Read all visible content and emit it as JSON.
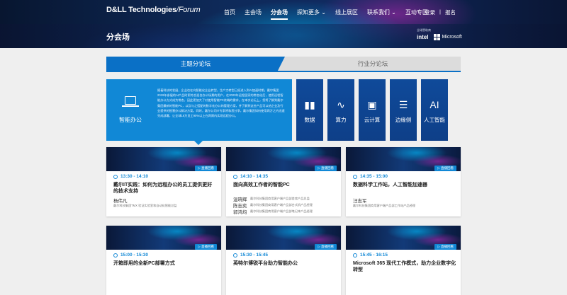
{
  "header": {
    "brand": "D&LL Technologies",
    "brand_suffix": "/Forum",
    "nav": [
      "首页",
      "主会场",
      "分会场",
      "探知更多 ⌄",
      "线上展区",
      "联系我们 ⌄",
      "互动专区 ⌄"
    ],
    "active_nav": "分会场",
    "login": "登录",
    "separator": "|",
    "register": "报名",
    "page_title": "分会场",
    "sponsor_caption": "全球赞助商",
    "sponsor_intel": "intel",
    "sponsor_ms": "Microsoft"
  },
  "tabs": {
    "active": "主题分论坛",
    "inactive": "行业分论坛"
  },
  "featured": {
    "icon": "laptop-icon",
    "name": "智能办公",
    "desc": "随着科技的发展，企业也在向智能化企业转型，生产力转型已经进入到AI加速时期。戴尔集团2019年参展的AI产品时更符合混合办公场景的用户，在2020年远程居家的常态化后，使用远程智能办公方式成为常态，因此更加大了对使用智能PC终端的需求。在本次论坛上，您将了解到戴尔集团最新的智能PC，以及与之搭配的数字化办公的管理方案，并了解到这些产品可以给企业及行业提供的智慧办公解决方案。同时，戴尔公司IT专家将和您分享，戴尔集团如何使用两万之内迅速完成部署，让全球16万员工90%以上在两周内实现远程办公。"
  },
  "topics": [
    {
      "glyph": "▮▮",
      "label": "数据",
      "icon": "bar-chart-icon"
    },
    {
      "glyph": "∿",
      "label": "算力",
      "icon": "line-chart-icon"
    },
    {
      "glyph": "▣",
      "label": "云计算",
      "icon": "monitor-icon"
    },
    {
      "glyph": "☰",
      "label": "边缘侧",
      "icon": "server-icon"
    },
    {
      "glyph": "AI",
      "label": "人工智能",
      "icon": "ai-icon"
    }
  ],
  "replay_label": "▷ 直播回看",
  "sessions": [
    {
      "time": "13:30 - 14:10",
      "title": "戴尔IT实践：如何为远程办公的员工提供更好的技术支持",
      "speakers": [
        {
          "name": "杨伟凡",
          "role": "戴尔科技集团TMX 验证实验室和自动化智能总监"
        }
      ]
    },
    {
      "time": "14:10 - 14:35",
      "title": "面向高效工作者的智能PC",
      "speakers": [
        {
          "name": "温晓辉",
          "role": "戴尔科技集团商用客户端产品部首席产品总监"
        },
        {
          "name": "陈志奕",
          "role": "戴尔科技集团商用客户端产品部台式机产品经理"
        },
        {
          "name": "郭鸿均",
          "role": "戴尔科技集团商用客户端产品部笔记本产品经理"
        }
      ]
    },
    {
      "time": "14:35 - 15:00",
      "title": "数据科学工作站，人工智能加速器",
      "speakers": [
        {
          "name": "汪志军",
          "role": "戴尔科技集团商用客户端产品部工作站产品经理"
        }
      ]
    },
    {
      "time": "15:00 - 15:30",
      "title": "开箱即用的全新PC部署方式",
      "speakers": [
        {
          "name": "",
          "role": ""
        }
      ]
    },
    {
      "time": "15:30 - 15:45",
      "title": "英特尔博锐平台助力智能办公",
      "speakers": [
        {
          "name": "",
          "role": ""
        }
      ]
    },
    {
      "time": "15:45 - 16:15",
      "title": "Microsoft 365  现代工作模式，助力企业数字化转型",
      "speakers": [
        {
          "name": "",
          "role": ""
        }
      ]
    }
  ]
}
